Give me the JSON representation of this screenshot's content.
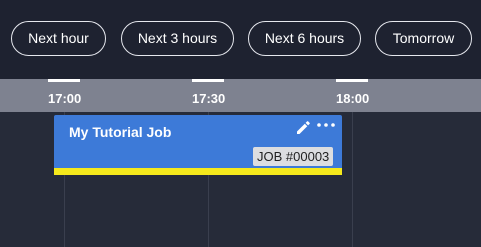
{
  "quick_ranges": [
    {
      "label": "Next hour"
    },
    {
      "label": "Next 3 hours"
    },
    {
      "label": "Next 6 hours"
    },
    {
      "label": "Tomorrow"
    }
  ],
  "timeline": {
    "ticks": [
      "17:00",
      "17:30",
      "18:00"
    ]
  },
  "job": {
    "title": "My Tutorial Job",
    "badge": "JOB #00003",
    "edit_icon": "pencil-icon",
    "more_icon": "ellipsis-icon",
    "color": "#3d7ad8",
    "stripe_color": "#f5e91c"
  }
}
